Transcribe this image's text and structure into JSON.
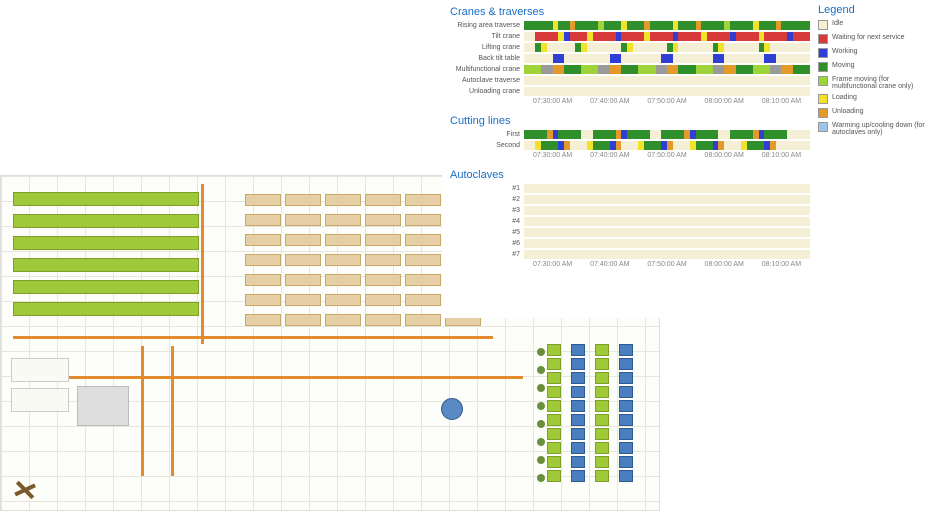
{
  "sections": {
    "cranes_title": "Cranes & traverses",
    "cutting_title": "Cutting lines",
    "autoclaves_title": "Autoclaves"
  },
  "legend": {
    "title": "Legend",
    "items": [
      {
        "label": "Idle",
        "class": "c-idle"
      },
      {
        "label": "Waiting for next service",
        "class": "c-wait"
      },
      {
        "label": "Working",
        "class": "c-work"
      },
      {
        "label": "Moving",
        "class": "c-move"
      },
      {
        "label": "Frame moving (for multifunctional crane only)",
        "class": "c-frame"
      },
      {
        "label": "Loading",
        "class": "c-load"
      },
      {
        "label": "Unloading",
        "class": "c-unload"
      },
      {
        "label": "Warming up/cooling down (for autoclaves only)",
        "class": "c-warm"
      }
    ]
  },
  "xaxis": {
    "ticks": [
      "07:30:00 AM",
      "07:40:00 AM",
      "07:50:00 AM",
      "08:00:00 AM",
      "08:10:00 AM"
    ]
  },
  "cranes": [
    {
      "label": "Rising area traverse"
    },
    {
      "label": "Tilt crane"
    },
    {
      "label": "Lifting crane"
    },
    {
      "label": "Back tilt table"
    },
    {
      "label": "Multifunctional crane"
    },
    {
      "label": "Autoclave traverse"
    },
    {
      "label": "Unloading crane"
    }
  ],
  "cutting": [
    {
      "label": "First"
    },
    {
      "label": "Second"
    }
  ],
  "autoclaves": [
    {
      "label": "#1"
    },
    {
      "label": "#2"
    },
    {
      "label": "#3"
    },
    {
      "label": "#4"
    },
    {
      "label": "#5"
    },
    {
      "label": "#6"
    },
    {
      "label": "#7"
    }
  ],
  "chart_data": {
    "type": "gantt",
    "time_range": [
      "07:25:00",
      "08:15:00"
    ],
    "legend": [
      "idle",
      "wait",
      "work",
      "move",
      "frame",
      "load",
      "unload",
      "warm"
    ],
    "cranes": [
      {
        "name": "Rising area traverse",
        "segments": [
          {
            "s": 0,
            "e": 10,
            "c": "move"
          },
          {
            "s": 10,
            "e": 12,
            "c": "load"
          },
          {
            "s": 12,
            "e": 16,
            "c": "move"
          },
          {
            "s": 16,
            "e": 18,
            "c": "unload"
          },
          {
            "s": 18,
            "e": 26,
            "c": "move"
          },
          {
            "s": 26,
            "e": 28,
            "c": "frame"
          },
          {
            "s": 28,
            "e": 34,
            "c": "move"
          },
          {
            "s": 34,
            "e": 36,
            "c": "load"
          },
          {
            "s": 36,
            "e": 42,
            "c": "move"
          },
          {
            "s": 42,
            "e": 44,
            "c": "unload"
          },
          {
            "s": 44,
            "e": 52,
            "c": "move"
          },
          {
            "s": 52,
            "e": 54,
            "c": "load"
          },
          {
            "s": 54,
            "e": 60,
            "c": "move"
          },
          {
            "s": 60,
            "e": 62,
            "c": "unload"
          },
          {
            "s": 62,
            "e": 70,
            "c": "move"
          },
          {
            "s": 70,
            "e": 72,
            "c": "frame"
          },
          {
            "s": 72,
            "e": 80,
            "c": "move"
          },
          {
            "s": 80,
            "e": 82,
            "c": "load"
          },
          {
            "s": 82,
            "e": 88,
            "c": "move"
          },
          {
            "s": 88,
            "e": 90,
            "c": "unload"
          },
          {
            "s": 90,
            "e": 100,
            "c": "move"
          }
        ]
      },
      {
        "name": "Tilt crane",
        "segments": [
          {
            "s": 0,
            "e": 4,
            "c": "idle"
          },
          {
            "s": 4,
            "e": 12,
            "c": "wait"
          },
          {
            "s": 12,
            "e": 14,
            "c": "load"
          },
          {
            "s": 14,
            "e": 16,
            "c": "work"
          },
          {
            "s": 16,
            "e": 22,
            "c": "wait"
          },
          {
            "s": 22,
            "e": 24,
            "c": "load"
          },
          {
            "s": 24,
            "e": 32,
            "c": "wait"
          },
          {
            "s": 32,
            "e": 34,
            "c": "work"
          },
          {
            "s": 34,
            "e": 42,
            "c": "wait"
          },
          {
            "s": 42,
            "e": 44,
            "c": "load"
          },
          {
            "s": 44,
            "e": 52,
            "c": "wait"
          },
          {
            "s": 52,
            "e": 54,
            "c": "work"
          },
          {
            "s": 54,
            "e": 62,
            "c": "wait"
          },
          {
            "s": 62,
            "e": 64,
            "c": "load"
          },
          {
            "s": 64,
            "e": 72,
            "c": "wait"
          },
          {
            "s": 72,
            "e": 74,
            "c": "work"
          },
          {
            "s": 74,
            "e": 82,
            "c": "wait"
          },
          {
            "s": 82,
            "e": 84,
            "c": "load"
          },
          {
            "s": 84,
            "e": 92,
            "c": "wait"
          },
          {
            "s": 92,
            "e": 94,
            "c": "work"
          },
          {
            "s": 94,
            "e": 100,
            "c": "wait"
          }
        ]
      },
      {
        "name": "Lifting crane",
        "segments": [
          {
            "s": 0,
            "e": 4,
            "c": "idle"
          },
          {
            "s": 4,
            "e": 6,
            "c": "move"
          },
          {
            "s": 6,
            "e": 8,
            "c": "load"
          },
          {
            "s": 8,
            "e": 18,
            "c": "idle"
          },
          {
            "s": 18,
            "e": 20,
            "c": "move"
          },
          {
            "s": 20,
            "e": 22,
            "c": "load"
          },
          {
            "s": 22,
            "e": 34,
            "c": "idle"
          },
          {
            "s": 34,
            "e": 36,
            "c": "move"
          },
          {
            "s": 36,
            "e": 38,
            "c": "load"
          },
          {
            "s": 38,
            "e": 50,
            "c": "idle"
          },
          {
            "s": 50,
            "e": 52,
            "c": "move"
          },
          {
            "s": 52,
            "e": 54,
            "c": "load"
          },
          {
            "s": 54,
            "e": 66,
            "c": "idle"
          },
          {
            "s": 66,
            "e": 68,
            "c": "move"
          },
          {
            "s": 68,
            "e": 70,
            "c": "load"
          },
          {
            "s": 70,
            "e": 82,
            "c": "idle"
          },
          {
            "s": 82,
            "e": 84,
            "c": "move"
          },
          {
            "s": 84,
            "e": 86,
            "c": "load"
          },
          {
            "s": 86,
            "e": 100,
            "c": "idle"
          }
        ]
      },
      {
        "name": "Back tilt table",
        "segments": [
          {
            "s": 0,
            "e": 10,
            "c": "idle"
          },
          {
            "s": 10,
            "e": 14,
            "c": "work"
          },
          {
            "s": 14,
            "e": 30,
            "c": "idle"
          },
          {
            "s": 30,
            "e": 34,
            "c": "work"
          },
          {
            "s": 34,
            "e": 48,
            "c": "idle"
          },
          {
            "s": 48,
            "e": 52,
            "c": "work"
          },
          {
            "s": 52,
            "e": 66,
            "c": "idle"
          },
          {
            "s": 66,
            "e": 70,
            "c": "work"
          },
          {
            "s": 70,
            "e": 84,
            "c": "idle"
          },
          {
            "s": 84,
            "e": 88,
            "c": "work"
          },
          {
            "s": 88,
            "e": 100,
            "c": "idle"
          }
        ]
      },
      {
        "name": "Multifunctional crane",
        "segments": [
          {
            "s": 0,
            "e": 6,
            "c": "frame"
          },
          {
            "s": 6,
            "e": 10,
            "c": "grey"
          },
          {
            "s": 10,
            "e": 14,
            "c": "unload"
          },
          {
            "s": 14,
            "e": 20,
            "c": "move"
          },
          {
            "s": 20,
            "e": 26,
            "c": "frame"
          },
          {
            "s": 26,
            "e": 30,
            "c": "grey"
          },
          {
            "s": 30,
            "e": 34,
            "c": "unload"
          },
          {
            "s": 34,
            "e": 40,
            "c": "move"
          },
          {
            "s": 40,
            "e": 46,
            "c": "frame"
          },
          {
            "s": 46,
            "e": 50,
            "c": "grey"
          },
          {
            "s": 50,
            "e": 54,
            "c": "unload"
          },
          {
            "s": 54,
            "e": 60,
            "c": "move"
          },
          {
            "s": 60,
            "e": 66,
            "c": "frame"
          },
          {
            "s": 66,
            "e": 70,
            "c": "grey"
          },
          {
            "s": 70,
            "e": 74,
            "c": "unload"
          },
          {
            "s": 74,
            "e": 80,
            "c": "move"
          },
          {
            "s": 80,
            "e": 86,
            "c": "frame"
          },
          {
            "s": 86,
            "e": 90,
            "c": "grey"
          },
          {
            "s": 90,
            "e": 94,
            "c": "unload"
          },
          {
            "s": 94,
            "e": 100,
            "c": "move"
          }
        ]
      },
      {
        "name": "Autoclave traverse",
        "segments": [
          {
            "s": 0,
            "e": 100,
            "c": "idle"
          }
        ]
      },
      {
        "name": "Unloading crane",
        "segments": [
          {
            "s": 0,
            "e": 100,
            "c": "idle"
          }
        ]
      }
    ],
    "cutting": [
      {
        "name": "First",
        "segments": [
          {
            "s": 0,
            "e": 8,
            "c": "move"
          },
          {
            "s": 8,
            "e": 10,
            "c": "unload"
          },
          {
            "s": 10,
            "e": 12,
            "c": "work"
          },
          {
            "s": 12,
            "e": 20,
            "c": "move"
          },
          {
            "s": 20,
            "e": 24,
            "c": "idle"
          },
          {
            "s": 24,
            "e": 32,
            "c": "move"
          },
          {
            "s": 32,
            "e": 34,
            "c": "unload"
          },
          {
            "s": 34,
            "e": 36,
            "c": "work"
          },
          {
            "s": 36,
            "e": 44,
            "c": "move"
          },
          {
            "s": 44,
            "e": 48,
            "c": "idle"
          },
          {
            "s": 48,
            "e": 56,
            "c": "move"
          },
          {
            "s": 56,
            "e": 58,
            "c": "unload"
          },
          {
            "s": 58,
            "e": 60,
            "c": "work"
          },
          {
            "s": 60,
            "e": 68,
            "c": "move"
          },
          {
            "s": 68,
            "e": 72,
            "c": "idle"
          },
          {
            "s": 72,
            "e": 80,
            "c": "move"
          },
          {
            "s": 80,
            "e": 82,
            "c": "unload"
          },
          {
            "s": 82,
            "e": 84,
            "c": "work"
          },
          {
            "s": 84,
            "e": 92,
            "c": "move"
          },
          {
            "s": 92,
            "e": 100,
            "c": "idle"
          }
        ]
      },
      {
        "name": "Second",
        "segments": [
          {
            "s": 0,
            "e": 4,
            "c": "idle"
          },
          {
            "s": 4,
            "e": 6,
            "c": "load"
          },
          {
            "s": 6,
            "e": 12,
            "c": "move"
          },
          {
            "s": 12,
            "e": 14,
            "c": "work"
          },
          {
            "s": 14,
            "e": 16,
            "c": "unload"
          },
          {
            "s": 16,
            "e": 22,
            "c": "idle"
          },
          {
            "s": 22,
            "e": 24,
            "c": "load"
          },
          {
            "s": 24,
            "e": 30,
            "c": "move"
          },
          {
            "s": 30,
            "e": 32,
            "c": "work"
          },
          {
            "s": 32,
            "e": 34,
            "c": "unload"
          },
          {
            "s": 34,
            "e": 40,
            "c": "idle"
          },
          {
            "s": 40,
            "e": 42,
            "c": "load"
          },
          {
            "s": 42,
            "e": 48,
            "c": "move"
          },
          {
            "s": 48,
            "e": 50,
            "c": "work"
          },
          {
            "s": 50,
            "e": 52,
            "c": "unload"
          },
          {
            "s": 52,
            "e": 58,
            "c": "idle"
          },
          {
            "s": 58,
            "e": 60,
            "c": "load"
          },
          {
            "s": 60,
            "e": 66,
            "c": "move"
          },
          {
            "s": 66,
            "e": 68,
            "c": "work"
          },
          {
            "s": 68,
            "e": 70,
            "c": "unload"
          },
          {
            "s": 70,
            "e": 76,
            "c": "idle"
          },
          {
            "s": 76,
            "e": 78,
            "c": "load"
          },
          {
            "s": 78,
            "e": 84,
            "c": "move"
          },
          {
            "s": 84,
            "e": 86,
            "c": "work"
          },
          {
            "s": 86,
            "e": 88,
            "c": "unload"
          },
          {
            "s": 88,
            "e": 100,
            "c": "idle"
          }
        ]
      }
    ],
    "autoclaves": [
      {
        "name": "#1",
        "segments": [
          {
            "s": 0,
            "e": 100,
            "c": "idle"
          }
        ]
      },
      {
        "name": "#2",
        "segments": [
          {
            "s": 0,
            "e": 100,
            "c": "idle"
          }
        ]
      },
      {
        "name": "#3",
        "segments": [
          {
            "s": 0,
            "e": 100,
            "c": "idle"
          }
        ]
      },
      {
        "name": "#4",
        "segments": [
          {
            "s": 0,
            "e": 100,
            "c": "idle"
          }
        ]
      },
      {
        "name": "#5",
        "segments": [
          {
            "s": 0,
            "e": 100,
            "c": "idle"
          }
        ]
      },
      {
        "name": "#6",
        "segments": [
          {
            "s": 0,
            "e": 100,
            "c": "idle"
          }
        ]
      },
      {
        "name": "#7",
        "segments": [
          {
            "s": 0,
            "e": 100,
            "c": "idle"
          }
        ]
      }
    ]
  }
}
